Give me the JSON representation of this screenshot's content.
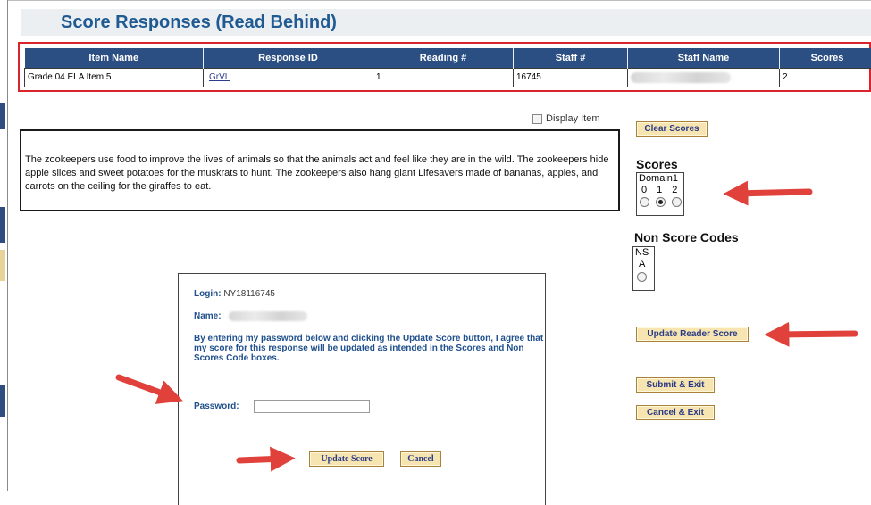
{
  "header": {
    "title": "Score Responses (Read Behind)"
  },
  "table": {
    "columns": [
      "Item Name",
      "Response ID",
      "Reading #",
      "Staff #",
      "Staff Name",
      "Scores"
    ],
    "row": {
      "item_name": "Grade 04 ELA Item 5",
      "response_id": "GrVL",
      "reading": "1",
      "staff_no": "16745",
      "scores": "2"
    }
  },
  "display_item": {
    "label": "Display Item"
  },
  "response_text": "The zookeepers use food to improve the lives of animals so that the animals act and feel like they are in the wild.  The zookeepers hide apple slices and sweet potatoes for the muskrats to hunt.  The zookeepers also hang giant Lifesavers made of bananas, apples, and carrots on the ceiling for the giraffes to eat.",
  "buttons": {
    "clear_scores": "Clear Scores",
    "update_reader_score": "Update Reader Score",
    "submit_exit": "Submit & Exit",
    "cancel_exit": "Cancel & Exit",
    "update_score": "Update Score",
    "cancel": "Cancel"
  },
  "scores": {
    "label": "Scores",
    "domain": "Domain1",
    "options": [
      "0",
      "1",
      "2"
    ],
    "selected": "1"
  },
  "non_score_codes": {
    "label": "Non Score Codes",
    "codes": [
      "NS",
      "A"
    ]
  },
  "login_panel": {
    "login_label": "Login:",
    "login_value": "NY18116745",
    "name_label": "Name:",
    "agreement": "By entering my password below and clicking the Update Score button, I agree that my score for this response will be updated as intended in the Scores and Non Scores Code boxes.",
    "password_label": "Password:"
  },
  "colors": {
    "title": "#1f5a92",
    "header_bg": "#2b4e83",
    "highlight_border": "#d9232d",
    "button_bg": "#f6e5b1",
    "button_text": "#2a3a86",
    "arrow": "#e0413a"
  }
}
